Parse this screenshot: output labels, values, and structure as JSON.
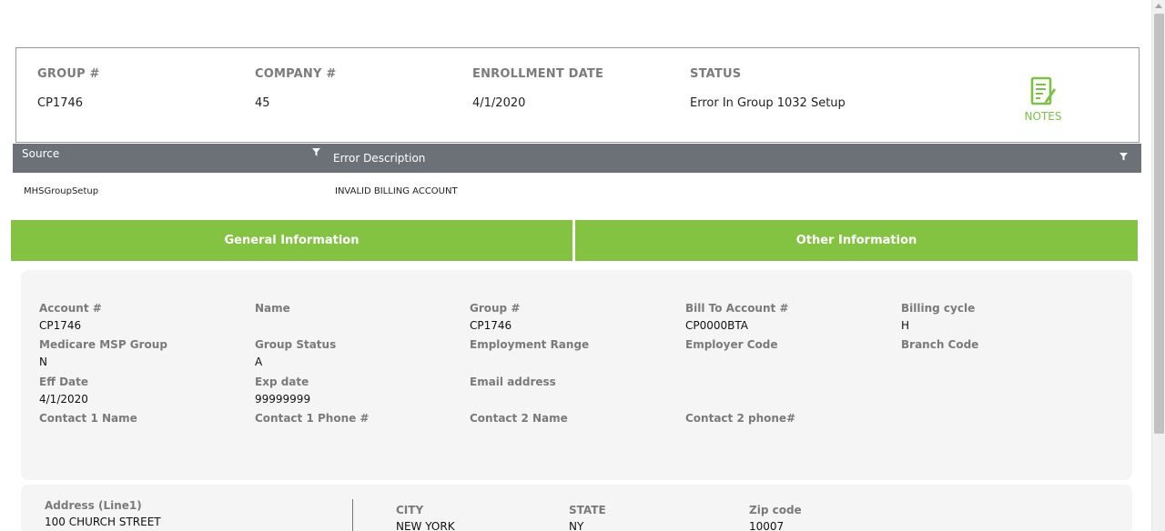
{
  "summary": {
    "group_label": "GROUP #",
    "group_value": "CP1746",
    "company_label": "COMPANY #",
    "company_value": "45",
    "enrollment_label": "ENROLLMENT DATE",
    "enrollment_value": "4/1/2020",
    "status_label": "STATUS",
    "status_value": "Error In Group 1032 Setup",
    "notes_label": "NOTES",
    "notes_icon": "notes-document-icon"
  },
  "errors": {
    "columns": [
      "Source",
      "Error Description"
    ],
    "rows": [
      {
        "source": "MHSGroupSetup",
        "description": "INVALID BILLING ACCOUNT"
      }
    ]
  },
  "tabs": [
    {
      "label": "General Information"
    },
    {
      "label": "Other Information"
    }
  ],
  "general": {
    "account_label": "Account #",
    "account_value": "CP1746",
    "name_label": "Name",
    "name_value": "",
    "group_label": "Group #",
    "group_value": "CP1746",
    "billto_label": "Bill To Account #",
    "billto_value": "CP0000BTA",
    "cycle_label": "Billing cycle",
    "cycle_value": "H",
    "msp_label": "Medicare MSP Group",
    "msp_value": "N",
    "gstatus_label": "Group Status",
    "gstatus_value": "A",
    "emprange_label": "Employment Range",
    "emprange_value": "",
    "empcode_label": "Employer Code",
    "empcode_value": "",
    "branch_label": "Branch Code",
    "branch_value": "",
    "eff_label": "Eff Date",
    "eff_value": "4/1/2020",
    "exp_label": "Exp date",
    "exp_value": "99999999",
    "email_label": "Email address",
    "email_value": "",
    "c1name_label": "Contact 1 Name",
    "c1name_value": "",
    "c1phone_label": "Contact 1 Phone #",
    "c1phone_value": "",
    "c2name_label": "Contact 2 Name",
    "c2name_value": "",
    "c2phone_label": "Contact 2 phone#",
    "c2phone_value": ""
  },
  "address": {
    "line1_label": "Address (Line1)",
    "line1_value": "100 CHURCH STREET",
    "city_label": "CITY",
    "city_value": "NEW YORK",
    "state_label": "STATE",
    "state_value": "NY",
    "zip_label": "Zip code",
    "zip_value": "10007"
  },
  "colors": {
    "accent_green": "#83c341",
    "header_gray": "#6c7077",
    "label_gray": "#7a7a7a"
  }
}
